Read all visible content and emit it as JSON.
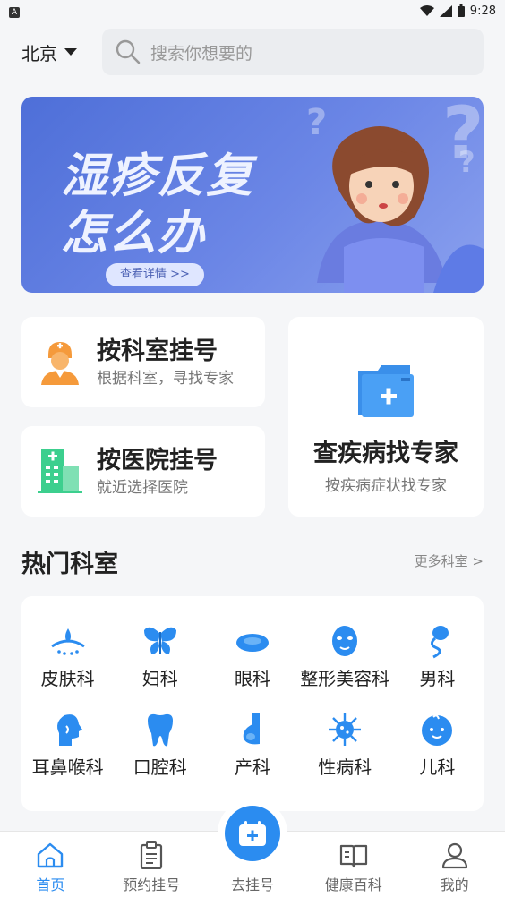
{
  "status_bar": {
    "time": "9:28",
    "notif_icon": "a-icon"
  },
  "header": {
    "city": "北京",
    "search_placeholder": "搜索你想要的"
  },
  "banner": {
    "line1": "湿疹反复",
    "line2": "怎么办",
    "detail_button": "查看详情 >>"
  },
  "quick_cards": {
    "by_department": {
      "title": "按科室挂号",
      "subtitle": "根据科室，寻找专家",
      "icon": "doctor-icon"
    },
    "by_hospital": {
      "title": "按医院挂号",
      "subtitle": "就近选择医院",
      "icon": "hospital-icon"
    },
    "by_disease": {
      "title": "查疾病找专家",
      "subtitle": "按疾病症状找专家",
      "icon": "medical-folder-icon"
    }
  },
  "departments": {
    "title": "热门科室",
    "more": "更多科室 >",
    "items": [
      {
        "label": "皮肤科",
        "icon": "skin-icon"
      },
      {
        "label": "妇科",
        "icon": "butterfly-icon"
      },
      {
        "label": "眼科",
        "icon": "eye-icon"
      },
      {
        "label": "整形美容科",
        "icon": "mask-icon"
      },
      {
        "label": "男科",
        "icon": "sperm-icon"
      },
      {
        "label": "耳鼻喉科",
        "icon": "head-profile-icon"
      },
      {
        "label": "口腔科",
        "icon": "tooth-icon"
      },
      {
        "label": "产科",
        "icon": "pregnancy-icon"
      },
      {
        "label": "性病科",
        "icon": "virus-icon"
      },
      {
        "label": "儿科",
        "icon": "baby-icon"
      }
    ]
  },
  "tabbar": {
    "items": [
      {
        "label": "首页",
        "icon": "home-icon",
        "active": true
      },
      {
        "label": "预约挂号",
        "icon": "clipboard-icon",
        "active": false
      },
      {
        "label": "去挂号",
        "icon": "calendar-plus-icon",
        "active": false
      },
      {
        "label": "健康百科",
        "icon": "book-icon",
        "active": false
      },
      {
        "label": "我的",
        "icon": "user-icon",
        "active": false
      }
    ]
  },
  "colors": {
    "accent": "#2b8cf0",
    "orange": "#f59a3b",
    "green": "#3ccf8e"
  }
}
